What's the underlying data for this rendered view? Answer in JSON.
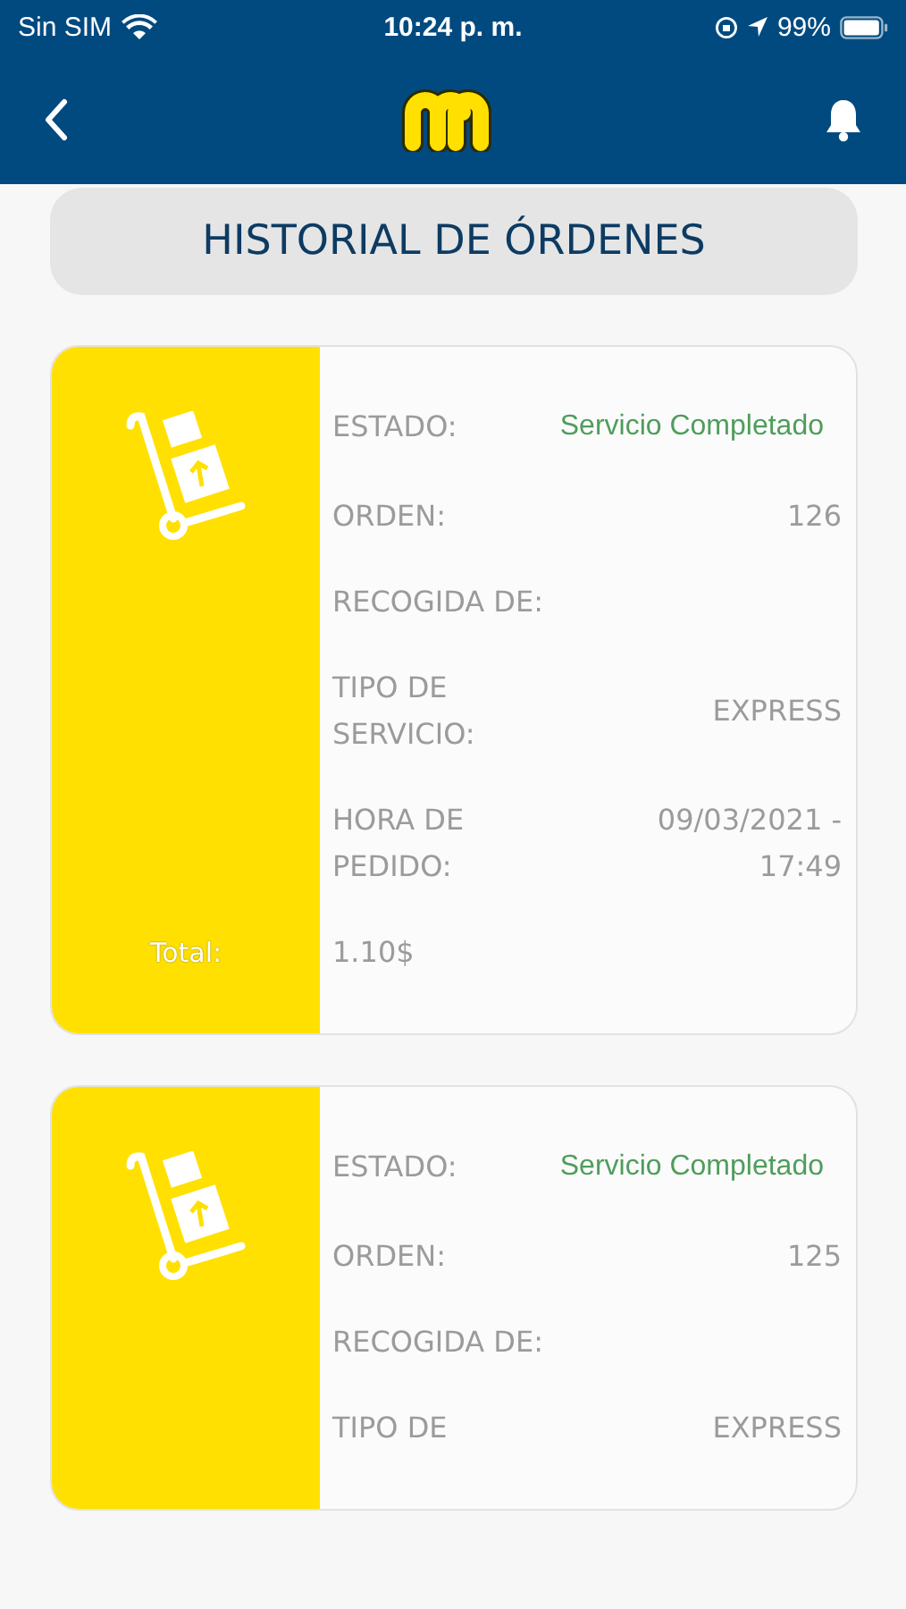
{
  "status_bar": {
    "carrier": "Sin SIM",
    "time": "10:24 p. m.",
    "battery": "99%"
  },
  "title": "HISTORIAL DE ÓRDENES",
  "orders": [
    {
      "fields": [
        {
          "kind": "status",
          "label": "ESTADO:",
          "value": "Servicio Completado"
        },
        {
          "kind": "plain",
          "label": "ORDEN:",
          "value": "126"
        },
        {
          "kind": "plain",
          "label": "RECOGIDA DE:"
        },
        {
          "kind": "plain",
          "label": "TIPO DE SERVICIO:",
          "value": "EXPRESS"
        },
        {
          "kind": "plain",
          "label": "HORA DE PEDIDO:",
          "value": "09/03/2021 - 17:49"
        }
      ],
      "total_label": "Total:",
      "total": "1.10$"
    },
    {
      "fields": [
        {
          "kind": "status",
          "label": "ESTADO:",
          "value": "Servicio Completado"
        },
        {
          "kind": "plain",
          "label": "ORDEN:",
          "value": "125"
        },
        {
          "kind": "plain",
          "label": "RECOGIDA DE:"
        },
        {
          "kind": "plain",
          "label": "TIPO DE",
          "value": "EXPRESS"
        }
      ]
    }
  ]
}
